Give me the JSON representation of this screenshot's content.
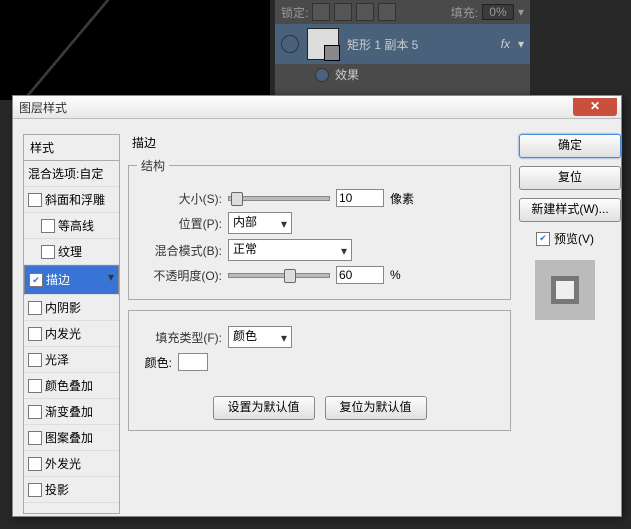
{
  "bgpanel": {
    "lock_label": "锁定:",
    "fill_label": "填充:",
    "fill_value": "0%",
    "layer_name": "矩形 1 副本 5",
    "fx": "fx",
    "effects": "效果"
  },
  "dialog": {
    "title": "图层样式",
    "ok": "确定",
    "cancel": "复位",
    "newstyle": "新建样式(W)...",
    "preview_label": "预览(V)"
  },
  "styles": {
    "header": "样式",
    "blend": "混合选项:自定",
    "items": [
      {
        "label": "斜面和浮雕",
        "checked": false,
        "indent": 0
      },
      {
        "label": "等高线",
        "checked": false,
        "indent": 1
      },
      {
        "label": "纹理",
        "checked": false,
        "indent": 1
      },
      {
        "label": "描边",
        "checked": true,
        "indent": 0,
        "selected": true
      },
      {
        "label": "内阴影",
        "checked": false,
        "indent": 0
      },
      {
        "label": "内发光",
        "checked": false,
        "indent": 0
      },
      {
        "label": "光泽",
        "checked": false,
        "indent": 0
      },
      {
        "label": "颜色叠加",
        "checked": false,
        "indent": 0
      },
      {
        "label": "渐变叠加",
        "checked": false,
        "indent": 0
      },
      {
        "label": "图案叠加",
        "checked": false,
        "indent": 0
      },
      {
        "label": "外发光",
        "checked": false,
        "indent": 0
      },
      {
        "label": "投影",
        "checked": false,
        "indent": 0
      }
    ]
  },
  "stroke": {
    "section": "描边",
    "struct": "结构",
    "size_label": "大小(S):",
    "size_value": "10",
    "size_unit": "像素",
    "pos_label": "位置(P):",
    "pos_value": "内部",
    "blend_label": "混合模式(B):",
    "blend_value": "正常",
    "opacity_label": "不透明度(O):",
    "opacity_value": "60",
    "opacity_unit": "%",
    "filltype_label": "填充类型(F):",
    "filltype_value": "颜色",
    "color_label": "颜色:",
    "default_btn": "设置为默认值",
    "reset_btn": "复位为默认值"
  }
}
